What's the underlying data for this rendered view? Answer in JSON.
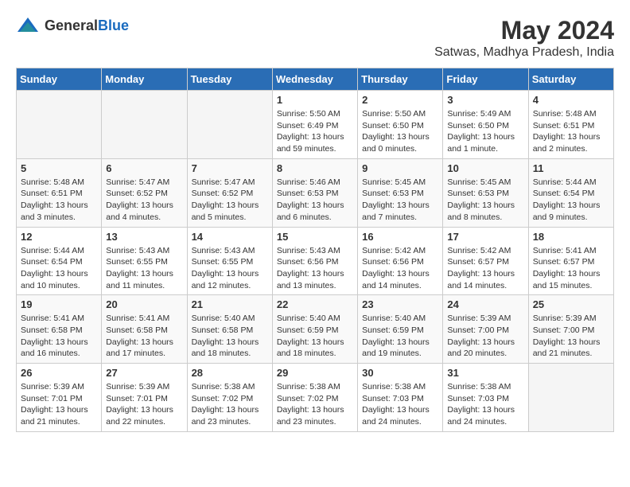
{
  "header": {
    "logo_general": "General",
    "logo_blue": "Blue",
    "month_year": "May 2024",
    "location": "Satwas, Madhya Pradesh, India"
  },
  "calendar": {
    "days_of_week": [
      "Sunday",
      "Monday",
      "Tuesday",
      "Wednesday",
      "Thursday",
      "Friday",
      "Saturday"
    ],
    "weeks": [
      [
        {
          "day": "",
          "info": ""
        },
        {
          "day": "",
          "info": ""
        },
        {
          "day": "",
          "info": ""
        },
        {
          "day": "1",
          "info": "Sunrise: 5:50 AM\nSunset: 6:49 PM\nDaylight: 13 hours\nand 59 minutes."
        },
        {
          "day": "2",
          "info": "Sunrise: 5:50 AM\nSunset: 6:50 PM\nDaylight: 13 hours\nand 0 minutes."
        },
        {
          "day": "3",
          "info": "Sunrise: 5:49 AM\nSunset: 6:50 PM\nDaylight: 13 hours\nand 1 minute."
        },
        {
          "day": "4",
          "info": "Sunrise: 5:48 AM\nSunset: 6:51 PM\nDaylight: 13 hours\nand 2 minutes."
        }
      ],
      [
        {
          "day": "5",
          "info": "Sunrise: 5:48 AM\nSunset: 6:51 PM\nDaylight: 13 hours\nand 3 minutes."
        },
        {
          "day": "6",
          "info": "Sunrise: 5:47 AM\nSunset: 6:52 PM\nDaylight: 13 hours\nand 4 minutes."
        },
        {
          "day": "7",
          "info": "Sunrise: 5:47 AM\nSunset: 6:52 PM\nDaylight: 13 hours\nand 5 minutes."
        },
        {
          "day": "8",
          "info": "Sunrise: 5:46 AM\nSunset: 6:53 PM\nDaylight: 13 hours\nand 6 minutes."
        },
        {
          "day": "9",
          "info": "Sunrise: 5:45 AM\nSunset: 6:53 PM\nDaylight: 13 hours\nand 7 minutes."
        },
        {
          "day": "10",
          "info": "Sunrise: 5:45 AM\nSunset: 6:53 PM\nDaylight: 13 hours\nand 8 minutes."
        },
        {
          "day": "11",
          "info": "Sunrise: 5:44 AM\nSunset: 6:54 PM\nDaylight: 13 hours\nand 9 minutes."
        }
      ],
      [
        {
          "day": "12",
          "info": "Sunrise: 5:44 AM\nSunset: 6:54 PM\nDaylight: 13 hours\nand 10 minutes."
        },
        {
          "day": "13",
          "info": "Sunrise: 5:43 AM\nSunset: 6:55 PM\nDaylight: 13 hours\nand 11 minutes."
        },
        {
          "day": "14",
          "info": "Sunrise: 5:43 AM\nSunset: 6:55 PM\nDaylight: 13 hours\nand 12 minutes."
        },
        {
          "day": "15",
          "info": "Sunrise: 5:43 AM\nSunset: 6:56 PM\nDaylight: 13 hours\nand 13 minutes."
        },
        {
          "day": "16",
          "info": "Sunrise: 5:42 AM\nSunset: 6:56 PM\nDaylight: 13 hours\nand 14 minutes."
        },
        {
          "day": "17",
          "info": "Sunrise: 5:42 AM\nSunset: 6:57 PM\nDaylight: 13 hours\nand 14 minutes."
        },
        {
          "day": "18",
          "info": "Sunrise: 5:41 AM\nSunset: 6:57 PM\nDaylight: 13 hours\nand 15 minutes."
        }
      ],
      [
        {
          "day": "19",
          "info": "Sunrise: 5:41 AM\nSunset: 6:58 PM\nDaylight: 13 hours\nand 16 minutes."
        },
        {
          "day": "20",
          "info": "Sunrise: 5:41 AM\nSunset: 6:58 PM\nDaylight: 13 hours\nand 17 minutes."
        },
        {
          "day": "21",
          "info": "Sunrise: 5:40 AM\nSunset: 6:58 PM\nDaylight: 13 hours\nand 18 minutes."
        },
        {
          "day": "22",
          "info": "Sunrise: 5:40 AM\nSunset: 6:59 PM\nDaylight: 13 hours\nand 18 minutes."
        },
        {
          "day": "23",
          "info": "Sunrise: 5:40 AM\nSunset: 6:59 PM\nDaylight: 13 hours\nand 19 minutes."
        },
        {
          "day": "24",
          "info": "Sunrise: 5:39 AM\nSunset: 7:00 PM\nDaylight: 13 hours\nand 20 minutes."
        },
        {
          "day": "25",
          "info": "Sunrise: 5:39 AM\nSunset: 7:00 PM\nDaylight: 13 hours\nand 21 minutes."
        }
      ],
      [
        {
          "day": "26",
          "info": "Sunrise: 5:39 AM\nSunset: 7:01 PM\nDaylight: 13 hours\nand 21 minutes."
        },
        {
          "day": "27",
          "info": "Sunrise: 5:39 AM\nSunset: 7:01 PM\nDaylight: 13 hours\nand 22 minutes."
        },
        {
          "day": "28",
          "info": "Sunrise: 5:38 AM\nSunset: 7:02 PM\nDaylight: 13 hours\nand 23 minutes."
        },
        {
          "day": "29",
          "info": "Sunrise: 5:38 AM\nSunset: 7:02 PM\nDaylight: 13 hours\nand 23 minutes."
        },
        {
          "day": "30",
          "info": "Sunrise: 5:38 AM\nSunset: 7:03 PM\nDaylight: 13 hours\nand 24 minutes."
        },
        {
          "day": "31",
          "info": "Sunrise: 5:38 AM\nSunset: 7:03 PM\nDaylight: 13 hours\nand 24 minutes."
        },
        {
          "day": "",
          "info": ""
        }
      ]
    ]
  }
}
